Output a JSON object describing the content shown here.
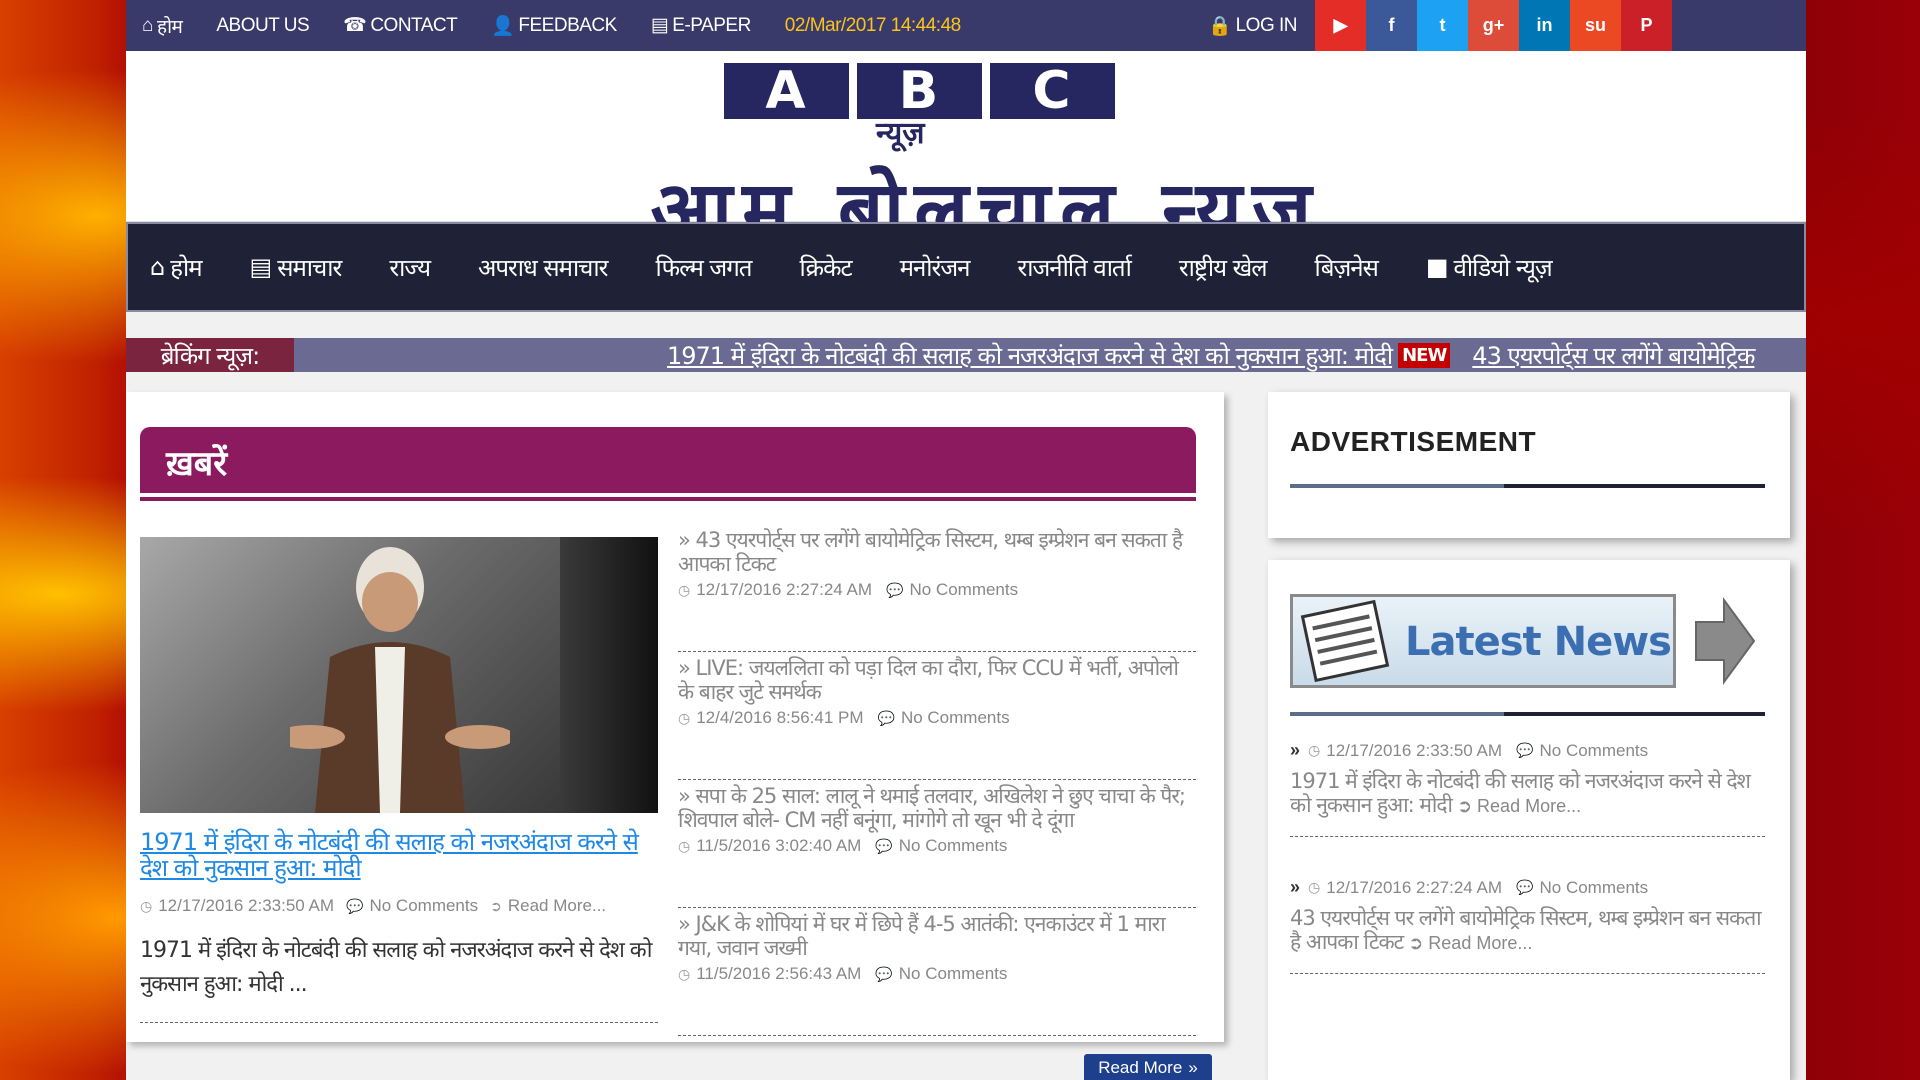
{
  "topbar": {
    "home": "होम",
    "about": "ABOUT US",
    "contact": "CONTACT",
    "feedback": "FEEDBACK",
    "epaper": "E-PAPER",
    "datetime": "02/Mar/2017 14:44:48",
    "login": "LOG IN",
    "social": [
      {
        "icon": "youtube-icon",
        "glyph": "▶",
        "color": "#e52d27"
      },
      {
        "icon": "facebook-icon",
        "glyph": "f",
        "color": "#3b5998"
      },
      {
        "icon": "twitter-icon",
        "glyph": "t",
        "color": "#1da1f2"
      },
      {
        "icon": "google-plus-icon",
        "glyph": "g+",
        "color": "#dd4b39"
      },
      {
        "icon": "linkedin-icon",
        "glyph": "in",
        "color": "#0077b5"
      },
      {
        "icon": "stumbleupon-icon",
        "glyph": "su",
        "color": "#eb4924"
      },
      {
        "icon": "pinterest-icon",
        "glyph": "P",
        "color": "#cb2027"
      }
    ]
  },
  "masthead": {
    "abc": [
      "A",
      "B",
      "C"
    ],
    "news_small": "न्यूज़",
    "title": "आम बोलचाल न्यूज़"
  },
  "nav": [
    "होम",
    "समाचार",
    "राज्य",
    "अपराध समाचार",
    "फिल्म जगत",
    "क्रिकेट",
    "मनोरंजन",
    "राजनीति वार्ता",
    "राष्ट्रीय खेल",
    "बिज़नेस",
    "वीडियो न्यूज़"
  ],
  "breaking": {
    "label": "ब्रेकिंग न्यूज़:",
    "item1": "1971 में इंदिरा के नोटबंदी की सलाह को नजरअंदाज करने से देश को नुकसान हुआ: मोदी",
    "badge": "NEW",
    "item2": "43 एयरपोर्ट्स पर लगेंगे बायोमेट्रिक"
  },
  "section": {
    "title": "ख़बरें",
    "hero": {
      "title": "1971 में इंदिरा के नोटबंदी की सलाह को नजरअंदाज करने से देश को नुकसान हुआ: मोदी",
      "date": "12/17/2016 2:33:50 AM",
      "comments": "No Comments",
      "readmore": "Read More...",
      "summary": "1971 में इंदिरा के नोटबंदी की सलाह को नजरअंदाज करने से देश को नुकसान हुआ: मोदी ..."
    },
    "list": [
      {
        "title": "» 43 एयरपोर्ट्स पर लगेंगे बायोमेट्रिक सिस्टम, थम्ब इम्प्रेशन बन सकता है आपका टिकट",
        "date": "12/17/2016 2:27:24 AM",
        "comments": "No Comments"
      },
      {
        "title": "» LIVE: जयललिता को पड़ा दिल का दौरा, फिर CCU में भर्ती, अपोलो के बाहर जुटे समर्थक",
        "date": "12/4/2016 8:56:41 PM",
        "comments": "No Comments"
      },
      {
        "title": "» सपा के 25 साल: लालू ने थमाई तलवार, अखिलेश ने छुए चाचा के पैर; शिवपाल बोले- CM नहीं बनूंगा, मांगोगे तो खून भी दे दूंगा",
        "date": "11/5/2016 3:02:40 AM",
        "comments": "No Comments"
      },
      {
        "title": "» J&K के शोपियां में घर में छिपे हैं 4-5 आतंकी: एनकाउंटर में 1 मारा गया, जवान जख्मी",
        "date": "11/5/2016 2:56:43 AM",
        "comments": "No Comments"
      }
    ],
    "readmore_button": "Read More"
  },
  "sidebar": {
    "ad_title": "ADVERTISEMENT",
    "latest_banner": "Latest News",
    "items": [
      {
        "date": "12/17/2016 2:33:50 AM",
        "comments": "No Comments",
        "title": "1971 में इंदिरा के नोटबंदी की सलाह को नजरअंदाज करने से देश को नुकसान हुआ: मोदी",
        "readmore": "Read More..."
      },
      {
        "date": "12/17/2016 2:27:24 AM",
        "comments": "No Comments",
        "title": "43 एयरपोर्ट्स पर लगेंगे बायोमेट्रिक सिस्टम, थम्ब इम्प्रेशन बन सकता है आपका टिकट",
        "readmore": "Read More..."
      }
    ]
  }
}
